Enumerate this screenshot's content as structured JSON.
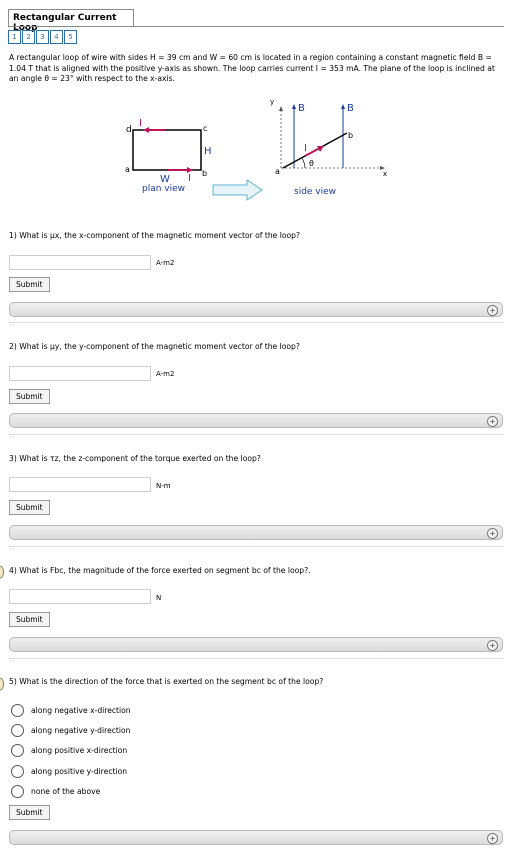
{
  "header": {
    "title": "Rectangular Current Loop",
    "pages": [
      "1",
      "2",
      "3",
      "4",
      "5"
    ]
  },
  "intro": "A rectangular loop of wire with sides H = 39 cm and W = 60 cm is located in a region containing a constant magnetic field B = 1.04 T that is aligned with the positive y-axis as shown. The loop carries current I = 353 mA. The plane of the loop is inclined at an angle θ = 23° with respect to the x-axis.",
  "figure": {
    "plan": {
      "d": "d",
      "c": "c",
      "a": "a",
      "b": "b",
      "I_top": "I",
      "I_bottom": "I",
      "H": "H",
      "W": "W",
      "caption": "plan view"
    },
    "side": {
      "y": "y",
      "B1": "B",
      "B2": "B",
      "I": "I",
      "theta": "θ",
      "a": "a",
      "b": "b",
      "x": "x",
      "caption": "side view"
    }
  },
  "questions": [
    {
      "text": "1) What is μx, the x-component of the magnetic moment vector of the loop?",
      "unit": "A-m2",
      "value": ""
    },
    {
      "text": "2) What is μy, the y-component of the magnetic moment vector of the loop?",
      "unit": "A-m2",
      "value": ""
    },
    {
      "text": "3) What is τz, the z-component of the torque exerted on the loop?",
      "unit": "N-m",
      "value": ""
    },
    {
      "text": "4) What is Fbc, the magnitude of the force exerted on segment bc of the loop?.",
      "unit": "N",
      "value": ""
    }
  ],
  "question5": {
    "text": "5) What is the direction of the force that is exerted on the segment bc of the loop?",
    "options": [
      "along negative x-direction",
      "along negative y-direction",
      "along positive x-direction",
      "along positive y-direction",
      "none of the above"
    ]
  },
  "submit_label": "Submit",
  "feedback_toggle": "+"
}
